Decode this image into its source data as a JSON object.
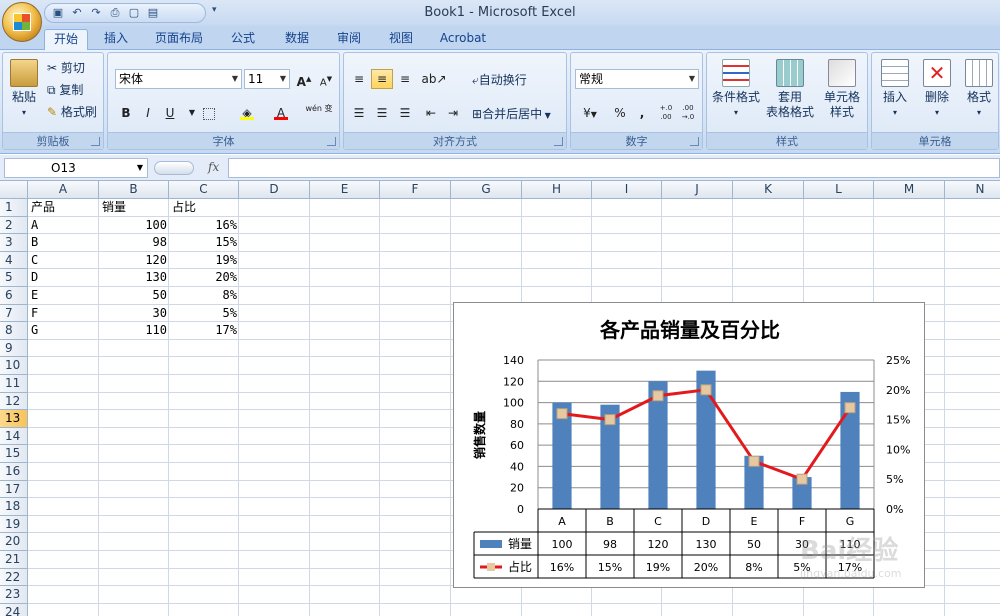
{
  "window": {
    "title": "Book1 - Microsoft Excel"
  },
  "qat": {
    "icons": [
      "save-icon",
      "undo-icon",
      "redo-icon",
      "print-preview-icon",
      "new-icon",
      "open-icon"
    ]
  },
  "tabs": [
    "开始",
    "插入",
    "页面布局",
    "公式",
    "数据",
    "审阅",
    "视图",
    "Acrobat"
  ],
  "ribbon": {
    "clipboard": {
      "paste": "粘贴",
      "cut": "剪切",
      "copy": "复制",
      "format_painter": "格式刷",
      "label": "剪贴板"
    },
    "font": {
      "name": "宋体",
      "size": "11",
      "grow": "A",
      "shrink": "A",
      "bold": "B",
      "italic": "I",
      "underline": "U",
      "font_color_letter": "A",
      "phonetic": "wén 变",
      "label": "字体"
    },
    "alignment": {
      "wrap": "自动换行",
      "merge": "合并后居中",
      "label": "对齐方式"
    },
    "number": {
      "format": "常规",
      "percent": "%",
      "comma": ",",
      "inc_decimal": "+.0 .00",
      "dec_decimal": ".00 →.0",
      "label": "数字"
    },
    "styles": {
      "conditional": "条件格式",
      "table_line1": "套用",
      "table_line2": "表格格式",
      "cell_style_line1": "单元格",
      "cell_style_line2": "样式",
      "label": "样式"
    },
    "cells": {
      "insert": "插入",
      "delete": "删除",
      "format": "格式",
      "label": "单元格"
    }
  },
  "formula_bar": {
    "name_box": "O13",
    "fx": "fx",
    "value": ""
  },
  "sheet": {
    "columns": [
      "A",
      "B",
      "C",
      "D",
      "E",
      "F",
      "G",
      "H",
      "I",
      "J",
      "K",
      "L",
      "M",
      "N"
    ],
    "rows": [
      "1",
      "2",
      "3",
      "4",
      "5",
      "6",
      "7",
      "8",
      "9",
      "10",
      "11",
      "12",
      "13",
      "14",
      "15",
      "16",
      "17",
      "18",
      "19",
      "20",
      "21",
      "22",
      "23",
      "24"
    ],
    "active_row": "13",
    "header": [
      "产品",
      "销量",
      "占比"
    ],
    "data": [
      [
        "A",
        "100",
        "16%"
      ],
      [
        "B",
        "98",
        "15%"
      ],
      [
        "C",
        "120",
        "19%"
      ],
      [
        "D",
        "130",
        "20%"
      ],
      [
        "E",
        "50",
        "8%"
      ],
      [
        "F",
        "30",
        "5%"
      ],
      [
        "G",
        "110",
        "17%"
      ]
    ]
  },
  "chart_data": {
    "type": "bar",
    "title": "各产品销量及百分比",
    "ylabel": "销售数量",
    "categories": [
      "A",
      "B",
      "C",
      "D",
      "E",
      "F",
      "G"
    ],
    "ylim": [
      0,
      140
    ],
    "y_ticks": [
      "0",
      "20",
      "40",
      "60",
      "80",
      "100",
      "120",
      "140"
    ],
    "y2lim": [
      0,
      0.25
    ],
    "y2_ticks": [
      "0%",
      "5%",
      "10%",
      "15%",
      "20%",
      "25%"
    ],
    "grid": true,
    "series": [
      {
        "name": "销量",
        "type": "bar",
        "axis": "left",
        "color": "#4f81bd",
        "values": [
          100,
          98,
          120,
          130,
          50,
          30,
          110
        ],
        "labels": [
          "100",
          "98",
          "120",
          "130",
          "50",
          "30",
          "110"
        ]
      },
      {
        "name": "占比",
        "type": "line",
        "axis": "right",
        "color": "#e3191c",
        "marker_color": "#e6c9a0",
        "values": [
          0.16,
          0.15,
          0.19,
          0.2,
          0.08,
          0.05,
          0.17
        ],
        "labels": [
          "16%",
          "15%",
          "19%",
          "20%",
          "8%",
          "5%",
          "17%"
        ]
      }
    ],
    "data_table": true
  },
  "watermark": {
    "text": "Bai经验",
    "subtext": "jingyan.baidu.com"
  }
}
